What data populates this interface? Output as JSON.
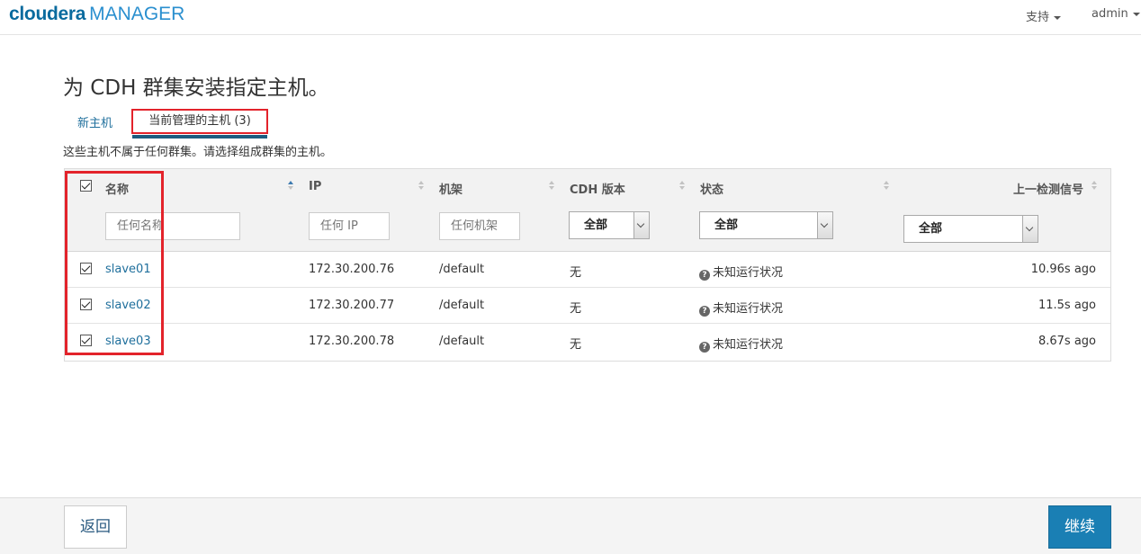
{
  "header": {
    "logo_brand": "cloudera",
    "logo_product": "MANAGER",
    "support_label": "支持",
    "user_label": "admin"
  },
  "page": {
    "title": "为 CDH 群集安装指定主机。",
    "tabs": [
      {
        "label": "新主机"
      },
      {
        "label": "当前管理的主机 (3)"
      }
    ],
    "description": "这些主机不属于任何群集。请选择组成群集的主机。"
  },
  "table": {
    "columns": [
      "名称",
      "IP",
      "机架",
      "CDH 版本",
      "状态",
      "上一检测信号"
    ],
    "filters": {
      "name_placeholder": "任何名称",
      "ip_placeholder": "任何 IP",
      "rack_placeholder": "任何机架",
      "cdh_select": "全部",
      "status_select": "全部",
      "heartbeat_select": "全部"
    },
    "rows": [
      {
        "name": "slave01",
        "ip": "172.30.200.76",
        "rack": "/default",
        "cdh": "无",
        "status": "未知运行状况",
        "heartbeat": "10.96s ago"
      },
      {
        "name": "slave02",
        "ip": "172.30.200.77",
        "rack": "/default",
        "cdh": "无",
        "status": "未知运行状况",
        "heartbeat": "11.5s ago"
      },
      {
        "name": "slave03",
        "ip": "172.30.200.78",
        "rack": "/default",
        "cdh": "无",
        "status": "未知运行状况",
        "heartbeat": "8.67s ago"
      }
    ]
  },
  "footer": {
    "back_label": "返回",
    "continue_label": "继续"
  },
  "colors": {
    "accent": "#1a7fb4",
    "highlight": "#e3232b",
    "link": "#1f6f9c"
  }
}
